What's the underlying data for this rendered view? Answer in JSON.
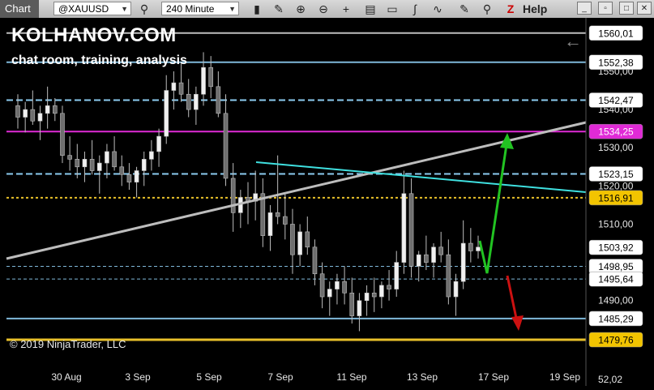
{
  "toolbar": {
    "chart_tab": "Chart",
    "instrument": "@XAUUSD",
    "interval": "240 Minute",
    "help": "Help",
    "icons": [
      "search-icon",
      "bar-type-icon",
      "pencil-icon",
      "zoom-in-icon",
      "zoom-out-icon",
      "crosshair-icon",
      "properties-icon",
      "data-box-icon",
      "indicators-icon",
      "strategies-icon",
      "drawing-icon",
      "zoom-icon"
    ]
  },
  "overlay": {
    "brand": "KOLHANOV.COM",
    "subtitle": "chat room, training, analysis",
    "copyright": "© 2019 NinjaTrader, LLC"
  },
  "chart_data": {
    "type": "candlestick",
    "instrument": "@XAUUSD",
    "interval": "240 Minute",
    "ylim": [
      1477,
      1564
    ],
    "y_ticks": [
      "1550,00",
      "1540,00",
      "1530,00",
      "1520,00",
      "1510,00",
      "1490,00"
    ],
    "x_ticks": [
      "30 Aug",
      "3 Sep",
      "5 Sep",
      "7 Sep",
      "11 Sep",
      "13 Sep",
      "17 Sep",
      "19 Sep"
    ],
    "bottom_partial_label": "52,02",
    "levels": [
      {
        "label": "1560,01",
        "value": 1560.01,
        "color": "#bdbdbd",
        "style": "solid",
        "box": "#ffffff",
        "text": "#000000"
      },
      {
        "label": "1552,38",
        "value": 1552.38,
        "color": "#7fb8d9",
        "style": "solid",
        "box": "#ffffff",
        "text": "#000000"
      },
      {
        "label": "1542,47",
        "value": 1542.47,
        "color": "#8ccbf0",
        "style": "dashed",
        "box": "#ffffff",
        "text": "#000000"
      },
      {
        "label": "1534,25",
        "value": 1534.25,
        "color": "#e02ad6",
        "style": "solid",
        "box": "#e02ad6",
        "text": "#ffffff"
      },
      {
        "label": "1523,15",
        "value": 1523.15,
        "color": "#8ccbf0",
        "style": "dashed",
        "box": "#ffffff",
        "text": "#000000"
      },
      {
        "label": "1516,91",
        "value": 1516.91,
        "color": "#e8c12a",
        "style": "dotted",
        "box": "#f2c400",
        "text": "#000000"
      },
      {
        "label": "1503,92",
        "value": 1503.92,
        "color": "none",
        "style": "none",
        "box": "#ffffff",
        "text": "#000000"
      },
      {
        "label": "1498,95",
        "value": 1498.95,
        "color": "#7fb8d9",
        "style": "dashed",
        "box": "#ffffff",
        "text": "#000000"
      },
      {
        "label": "1495,64",
        "value": 1495.64,
        "color": "#7fb8d9",
        "style": "dashed",
        "box": "#ffffff",
        "text": "#000000"
      },
      {
        "label": "1485,29",
        "value": 1485.29,
        "color": "#7fb8d9",
        "style": "solid",
        "box": "#ffffff",
        "text": "#000000"
      },
      {
        "label": "1479,76",
        "value": 1479.76,
        "color": "#e8c12a",
        "style": "thick",
        "box": "#f2c400",
        "text": "#000000"
      }
    ],
    "candles": [
      [
        1541,
        1544,
        1535,
        1538
      ],
      [
        1538,
        1542,
        1534,
        1540
      ],
      [
        1540,
        1545,
        1536,
        1537
      ],
      [
        1537,
        1541,
        1532,
        1539
      ],
      [
        1539,
        1546,
        1535,
        1541
      ],
      [
        1541,
        1543,
        1537,
        1539
      ],
      [
        1539,
        1541,
        1526,
        1528
      ],
      [
        1528,
        1533,
        1524,
        1527
      ],
      [
        1527,
        1531,
        1522,
        1525
      ],
      [
        1525,
        1529,
        1521,
        1527
      ],
      [
        1527,
        1532,
        1523,
        1524
      ],
      [
        1524,
        1528,
        1518,
        1526
      ],
      [
        1526,
        1531,
        1522,
        1529
      ],
      [
        1529,
        1533,
        1524,
        1525
      ],
      [
        1525,
        1528,
        1520,
        1523
      ],
      [
        1523,
        1526,
        1519,
        1521
      ],
      [
        1521,
        1525,
        1517,
        1524
      ],
      [
        1524,
        1529,
        1520,
        1527
      ],
      [
        1527,
        1532,
        1524,
        1529
      ],
      [
        1529,
        1535,
        1525,
        1533
      ],
      [
        1533,
        1549,
        1531,
        1545
      ],
      [
        1545,
        1550,
        1540,
        1547
      ],
      [
        1547,
        1552,
        1542,
        1544
      ],
      [
        1544,
        1548,
        1538,
        1540
      ],
      [
        1540,
        1546,
        1536,
        1544
      ],
      [
        1544,
        1555,
        1541,
        1551
      ],
      [
        1551,
        1554,
        1543,
        1546
      ],
      [
        1546,
        1550,
        1538,
        1539
      ],
      [
        1539,
        1544,
        1520,
        1522
      ],
      [
        1522,
        1526,
        1508,
        1513
      ],
      [
        1513,
        1519,
        1509,
        1517
      ],
      [
        1517,
        1521,
        1510,
        1516
      ],
      [
        1516,
        1524,
        1511,
        1518
      ],
      [
        1518,
        1522,
        1504,
        1507
      ],
      [
        1507,
        1515,
        1503,
        1513
      ],
      [
        1513,
        1528,
        1510,
        1512
      ],
      [
        1512,
        1518,
        1506,
        1510
      ],
      [
        1510,
        1514,
        1497,
        1502
      ],
      [
        1502,
        1510,
        1499,
        1508
      ],
      [
        1508,
        1512,
        1502,
        1504
      ],
      [
        1504,
        1506,
        1494,
        1497
      ],
      [
        1497,
        1500,
        1488,
        1491
      ],
      [
        1491,
        1495,
        1486,
        1493
      ],
      [
        1493,
        1497,
        1489,
        1495
      ],
      [
        1495,
        1499,
        1489,
        1492
      ],
      [
        1492,
        1496,
        1484,
        1486
      ],
      [
        1486,
        1492,
        1482,
        1490
      ],
      [
        1490,
        1494,
        1486,
        1492
      ],
      [
        1492,
        1496,
        1487,
        1491
      ],
      [
        1491,
        1495,
        1488,
        1494
      ],
      [
        1494,
        1498,
        1490,
        1493
      ],
      [
        1493,
        1503,
        1491,
        1500
      ],
      [
        1500,
        1524,
        1497,
        1518
      ],
      [
        1518,
        1522,
        1496,
        1499
      ],
      [
        1499,
        1503,
        1495,
        1502
      ],
      [
        1502,
        1507,
        1498,
        1500
      ],
      [
        1500,
        1505,
        1496,
        1504
      ],
      [
        1504,
        1508,
        1500,
        1502
      ],
      [
        1502,
        1506,
        1489,
        1491
      ],
      [
        1491,
        1497,
        1486,
        1495
      ],
      [
        1495,
        1511,
        1493,
        1505
      ],
      [
        1505,
        1509,
        1500,
        1503
      ],
      [
        1503,
        1507,
        1501,
        1504
      ]
    ],
    "annotations": {
      "trendline": {
        "color": "#bdbdbd"
      },
      "cyan_line": {
        "color": "#3fe0e0"
      },
      "green_arrow": {
        "color": "#22c322"
      },
      "red_arrow": {
        "color": "#cc1111"
      }
    }
  }
}
